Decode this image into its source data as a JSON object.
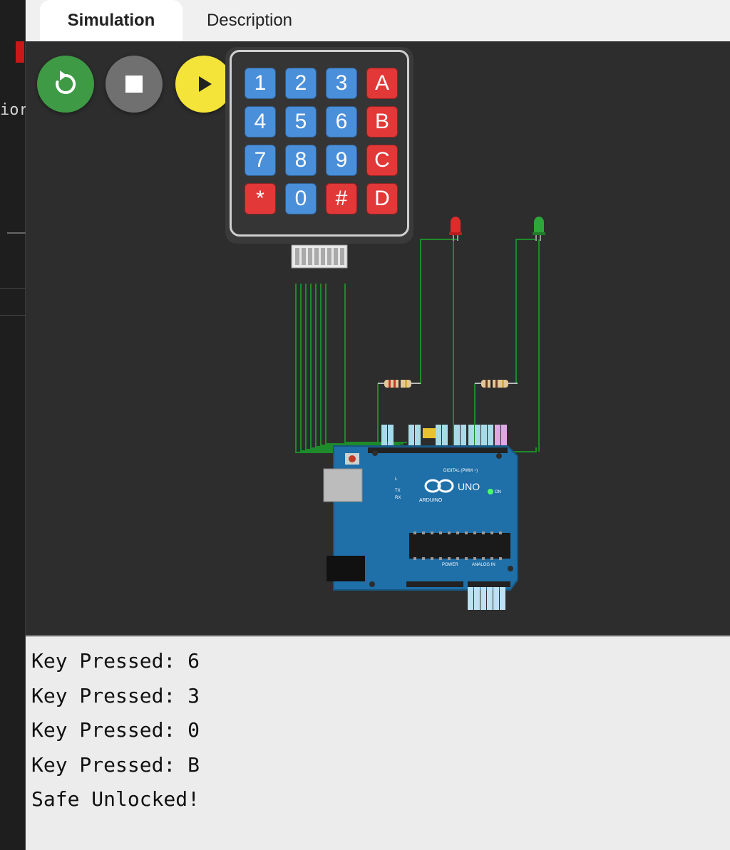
{
  "tabs": [
    {
      "label": "Simulation",
      "active": true
    },
    {
      "label": "Description",
      "active": false
    }
  ],
  "editor_fragment": "ior",
  "controls": {
    "restart": "restart-icon",
    "stop": "stop-icon",
    "play": "play-icon"
  },
  "keypad": {
    "keys": [
      "1",
      "2",
      "3",
      "A",
      "4",
      "5",
      "6",
      "B",
      "7",
      "8",
      "9",
      "C",
      "*",
      "0",
      "#",
      "D"
    ]
  },
  "board": {
    "model": "UNO",
    "brand": "ARDUINO",
    "labels": [
      "DIGITAL (PWM ~)",
      "ANALOG IN",
      "POWER",
      "ON",
      "TX",
      "RX",
      "L"
    ]
  },
  "leds": [
    "red",
    "green"
  ],
  "serial_monitor": {
    "lines": [
      "Key Pressed: 6",
      "Key Pressed: 3",
      "Key Pressed: 0",
      "Key Pressed: B",
      "Safe Unlocked!"
    ]
  },
  "colors": {
    "restart": "#3e9a45",
    "stop": "#707070",
    "play": "#f4e43a",
    "key_blue": "#4a8fd9",
    "key_red": "#e23838",
    "board": "#1f6fa8",
    "wire": "#1e8a2a"
  }
}
